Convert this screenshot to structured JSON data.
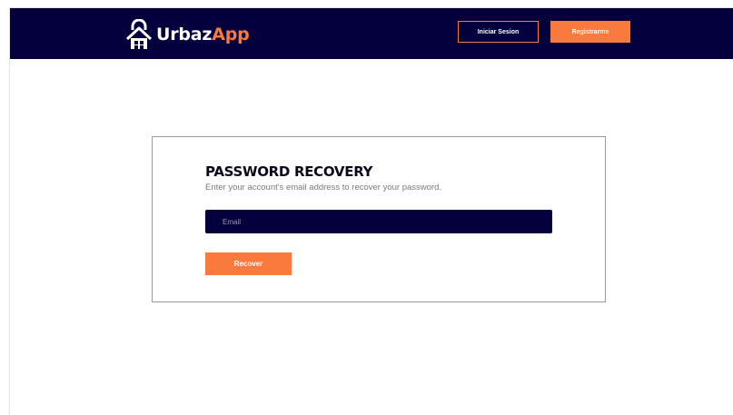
{
  "header": {
    "logo": {
      "icon": "house-lock-icon",
      "text_part1": "Urbaz",
      "text_part2": "App"
    },
    "login_label": "Iniciar Sesion",
    "register_label": "Registrarme"
  },
  "recovery": {
    "title": "PASSWORD RECOVERY",
    "subtitle": "Enter your account's email address to recover your password.",
    "email": {
      "value": "",
      "placeholder": "Email"
    },
    "submit_label": "Recover"
  },
  "colors": {
    "navy": "#04003d",
    "accent": "#f97a3c",
    "background": "#ffffff"
  }
}
